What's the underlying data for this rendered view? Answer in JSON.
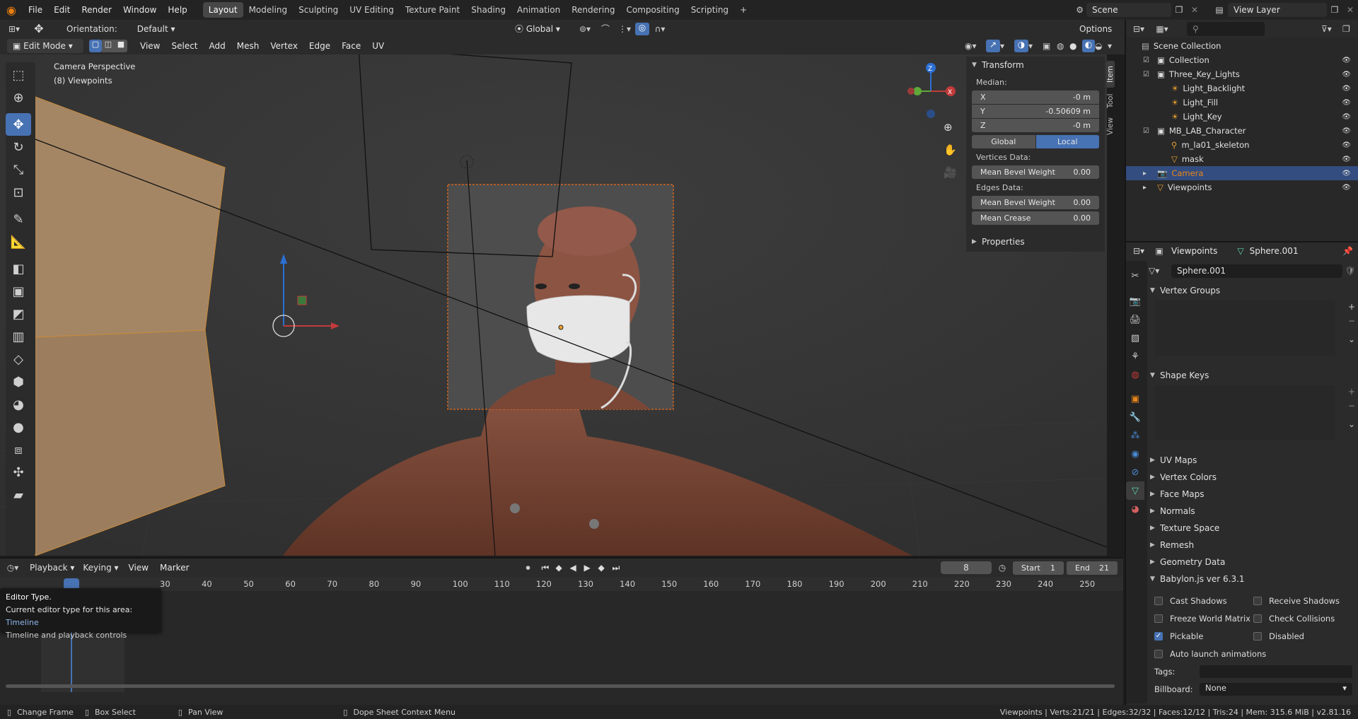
{
  "topbar": {
    "menus": [
      "File",
      "Edit",
      "Render",
      "Window",
      "Help"
    ],
    "workspaces": [
      "Layout",
      "Modeling",
      "Sculpting",
      "UV Editing",
      "Texture Paint",
      "Shading",
      "Animation",
      "Rendering",
      "Compositing",
      "Scripting"
    ],
    "active_workspace": "Layout",
    "add_tab": "+",
    "scene_name": "Scene",
    "view_layer": "View Layer"
  },
  "tool_settings": {
    "orientation_label": "Orientation:",
    "orientation_value": "Default",
    "transform_orientation": "Global",
    "options_label": "Options"
  },
  "viewport_header": {
    "mode": "Edit Mode",
    "menus": [
      "View",
      "Select",
      "Add",
      "Mesh",
      "Vertex",
      "Edge",
      "Face",
      "UV"
    ]
  },
  "viewport": {
    "overlay_line1": "Camera Perspective",
    "overlay_line2": "(8) Viewpoints",
    "gizmo_z": "Z",
    "gizmo_x": "X"
  },
  "npanel": {
    "tabs": [
      "Item",
      "Tool",
      "View"
    ],
    "transform_title": "Transform",
    "median_label": "Median:",
    "x_label": "X",
    "x_value": "-0 m",
    "y_label": "Y",
    "y_value": "-0.50609 m",
    "z_label": "Z",
    "z_value": "-0 m",
    "global_btn": "Global",
    "local_btn": "Local",
    "vertices_data": "Vertices Data:",
    "mean_bevel_weight_label": "Mean Bevel Weight",
    "vert_bevel_value": "0.00",
    "edges_data": "Edges Data:",
    "edge_bevel_value": "0.00",
    "mean_crease_label": "Mean Crease",
    "mean_crease_value": "0.00",
    "properties_title": "Properties"
  },
  "outliner": {
    "scene_collection": "Scene Collection",
    "items": [
      {
        "label": "Collection",
        "indent": 1,
        "type": "collection"
      },
      {
        "label": "Three_Key_Lights",
        "indent": 1,
        "type": "collection"
      },
      {
        "label": "Light_Backlight",
        "indent": 2,
        "type": "light"
      },
      {
        "label": "Light_Fill",
        "indent": 2,
        "type": "light"
      },
      {
        "label": "Light_Key",
        "indent": 2,
        "type": "light"
      },
      {
        "label": "MB_LAB_Character",
        "indent": 1,
        "type": "collection"
      },
      {
        "label": "m_la01_skeleton",
        "indent": 2,
        "type": "armature"
      },
      {
        "label": "mask",
        "indent": 2,
        "type": "mesh"
      },
      {
        "label": "Camera",
        "indent": 1,
        "type": "camera",
        "selected": true
      },
      {
        "label": "Viewpoints",
        "indent": 1,
        "type": "mesh"
      }
    ]
  },
  "properties": {
    "breadcrumb_object": "Viewpoints",
    "breadcrumb_data": "Sphere.001",
    "data_name": "Sphere.001",
    "sections_open": [
      "Vertex Groups",
      "Shape Keys"
    ],
    "sections_closed": [
      "UV Maps",
      "Vertex Colors",
      "Face Maps",
      "Normals",
      "Texture Space",
      "Remesh",
      "Geometry Data"
    ],
    "babylon_title": "Babylon.js ver 6.3.1",
    "cast_shadows": "Cast Shadows",
    "receive_shadows": "Receive Shadows",
    "freeze_world_matrix": "Freeze World Matrix",
    "check_collisions": "Check Collisions",
    "pickable": "Pickable",
    "disabled": "Disabled",
    "auto_launch": "Auto launch animations",
    "tags_label": "Tags:",
    "billboard_label": "Billboard:",
    "billboard_value": "None"
  },
  "timeline": {
    "menus": [
      "Playback",
      "Keying",
      "View",
      "Marker"
    ],
    "current_frame": "8",
    "start_label": "Start",
    "start_value": "1",
    "end_label": "End",
    "end_value": "21",
    "ticks": [
      "30",
      "40",
      "50",
      "60",
      "70",
      "80",
      "90",
      "100",
      "110",
      "120",
      "130",
      "140",
      "150",
      "160",
      "170",
      "180",
      "190",
      "200",
      "210",
      "220",
      "230",
      "240",
      "250"
    ],
    "tooltip_title": "Editor Type.",
    "tooltip_line": "Current editor type for this area:",
    "tooltip_value": "Timeline",
    "tooltip_desc": "Timeline and playback controls"
  },
  "statusbar": {
    "change_frame": "Change Frame",
    "box_select": "Box Select",
    "pan_view": "Pan View",
    "context_menu": "Dope Sheet Context Menu",
    "stats": "Viewpoints | Verts:21/21 | Edges:32/32 | Faces:12/12 | Tris:24 | Mem: 315.6 MiB | v2.81.16"
  }
}
